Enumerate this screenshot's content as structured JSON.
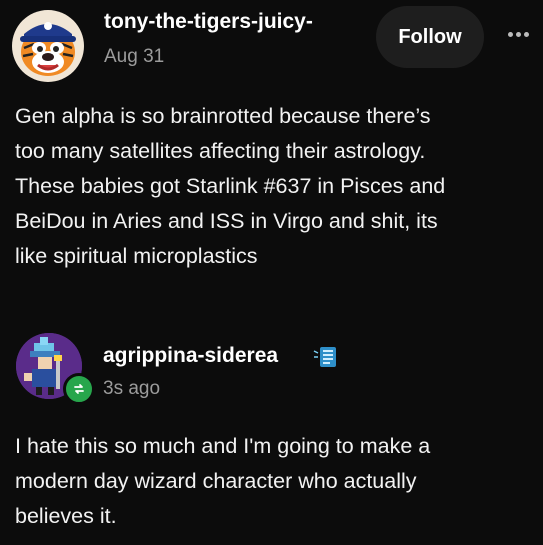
{
  "post": {
    "username": "tony-the-tigers-juicy-",
    "timestamp": "Aug 31",
    "follow_label": "Follow",
    "more_icon": "more-horizontal-icon",
    "text": "Gen alpha is so brainrotted because there’s\ntoo many satellites affecting their astrology.\nThese babies got Starlink #637 in Pisces and\nBeiDou in Aries and ISS in Virgo and shit, its\nlike spiritual microplastics"
  },
  "reply": {
    "username": "agrippina-siderea",
    "timestamp": "3s ago",
    "badge_icon": "reblog-icon",
    "text": "I hate this so much and I'm going to make a\nmodern day wizard character who actually\nbelieves it."
  },
  "colors": {
    "background": "#0c0c0c",
    "text": "#f2f2f2",
    "muted": "#9c9c9c",
    "follow_bg": "#1e1e1e",
    "reblog_green": "#27a64c"
  }
}
